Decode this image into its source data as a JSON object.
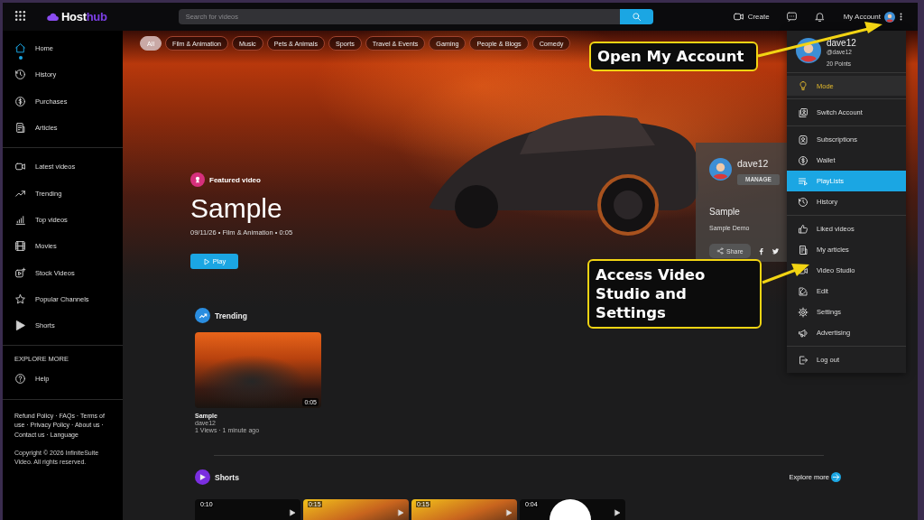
{
  "topbar": {
    "logo": {
      "name": "Host",
      "accent": "hub"
    },
    "search": {
      "placeholder": "Search for videos"
    },
    "create": "Create",
    "account": "My Account"
  },
  "sidebar": {
    "sections": [
      {
        "items": [
          {
            "label": "Home",
            "selected": true
          },
          {
            "label": "History",
            "selected": false
          },
          {
            "label": "Purchases",
            "selected": false
          },
          {
            "label": "Articles",
            "selected": false
          }
        ]
      },
      {
        "items": [
          {
            "label": "Latest videos",
            "selected": false
          },
          {
            "label": "Trending",
            "selected": false
          },
          {
            "label": "Top videos",
            "selected": false
          },
          {
            "label": "Movies",
            "selected": false
          },
          {
            "label": "Stock Videos",
            "selected": false
          },
          {
            "label": "Popular Channels",
            "selected": false
          },
          {
            "label": "Shorts",
            "selected": false
          }
        ]
      },
      {
        "heading": "EXPLORE MORE",
        "items": [
          {
            "label": "Help",
            "selected": false
          }
        ]
      }
    ],
    "footer_links": "Refund Policy · FAQs · Terms of use · Privacy Policy · About us · Contact us · Language",
    "copyright": "Copyright © 2026 InfiniteSuite Video. All rights reserved."
  },
  "categories": [
    {
      "label": "All",
      "selected": true
    },
    {
      "label": "Film & Animation",
      "selected": false
    },
    {
      "label": "Music",
      "selected": false
    },
    {
      "label": "Pets & Animals",
      "selected": false
    },
    {
      "label": "Sports",
      "selected": false
    },
    {
      "label": "Travel & Events",
      "selected": false
    },
    {
      "label": "Gaming",
      "selected": false
    },
    {
      "label": "People & Blogs",
      "selected": false
    },
    {
      "label": "Comedy",
      "selected": false
    }
  ],
  "featured": {
    "badge": "Featured video",
    "title": "Sample",
    "meta": "09/11/26 • Film & Animation • 0:05",
    "play": "Play"
  },
  "channel_panel": {
    "name": "dave12",
    "manage": "MANAGE",
    "title": "Sample",
    "description": "Sample Demo",
    "share": "Share"
  },
  "trending": {
    "heading": "Trending",
    "videos": [
      {
        "title": "Sample",
        "channel": "dave12",
        "stats": "1 Views · 1 minute ago",
        "duration": "0:05"
      }
    ]
  },
  "shorts": {
    "heading": "Shorts",
    "explore": "Explore more",
    "items": [
      {
        "kind": "dark",
        "duration": "0:10"
      },
      {
        "kind": "photo",
        "duration": "0:15"
      },
      {
        "kind": "photo",
        "duration": "0:15"
      },
      {
        "kind": "avatar",
        "duration": "0:04"
      }
    ]
  },
  "account_menu": {
    "name": "dave12",
    "handle": "@dave12",
    "points": "20 Points",
    "groups": [
      {
        "items": [
          {
            "label": "Mode",
            "kind": "mode",
            "selected": false
          }
        ]
      },
      {
        "items": [
          {
            "label": "Switch Account",
            "kind": "link",
            "selected": false
          }
        ]
      },
      {
        "items": [
          {
            "label": "Subscriptions",
            "kind": "link",
            "selected": false
          },
          {
            "label": "Wallet",
            "kind": "link",
            "selected": false
          },
          {
            "label": "PlayLists",
            "kind": "link",
            "selected": true
          },
          {
            "label": "History",
            "kind": "link",
            "selected": false
          }
        ]
      },
      {
        "items": [
          {
            "label": "Liked videos",
            "kind": "link",
            "selected": false
          },
          {
            "label": "My articles",
            "kind": "link",
            "selected": false
          },
          {
            "label": "Video Studio",
            "kind": "link",
            "selected": false
          },
          {
            "label": "Edit",
            "kind": "link",
            "selected": false
          },
          {
            "label": "Settings",
            "kind": "link",
            "selected": false
          },
          {
            "label": "Advertising",
            "kind": "link",
            "selected": false
          }
        ]
      },
      {
        "items": [
          {
            "label": "Log out",
            "kind": "link",
            "selected": false
          }
        ]
      }
    ]
  },
  "callouts": [
    {
      "text": "Open My Account"
    },
    {
      "text": "Access Video Studio and Settings"
    }
  ]
}
